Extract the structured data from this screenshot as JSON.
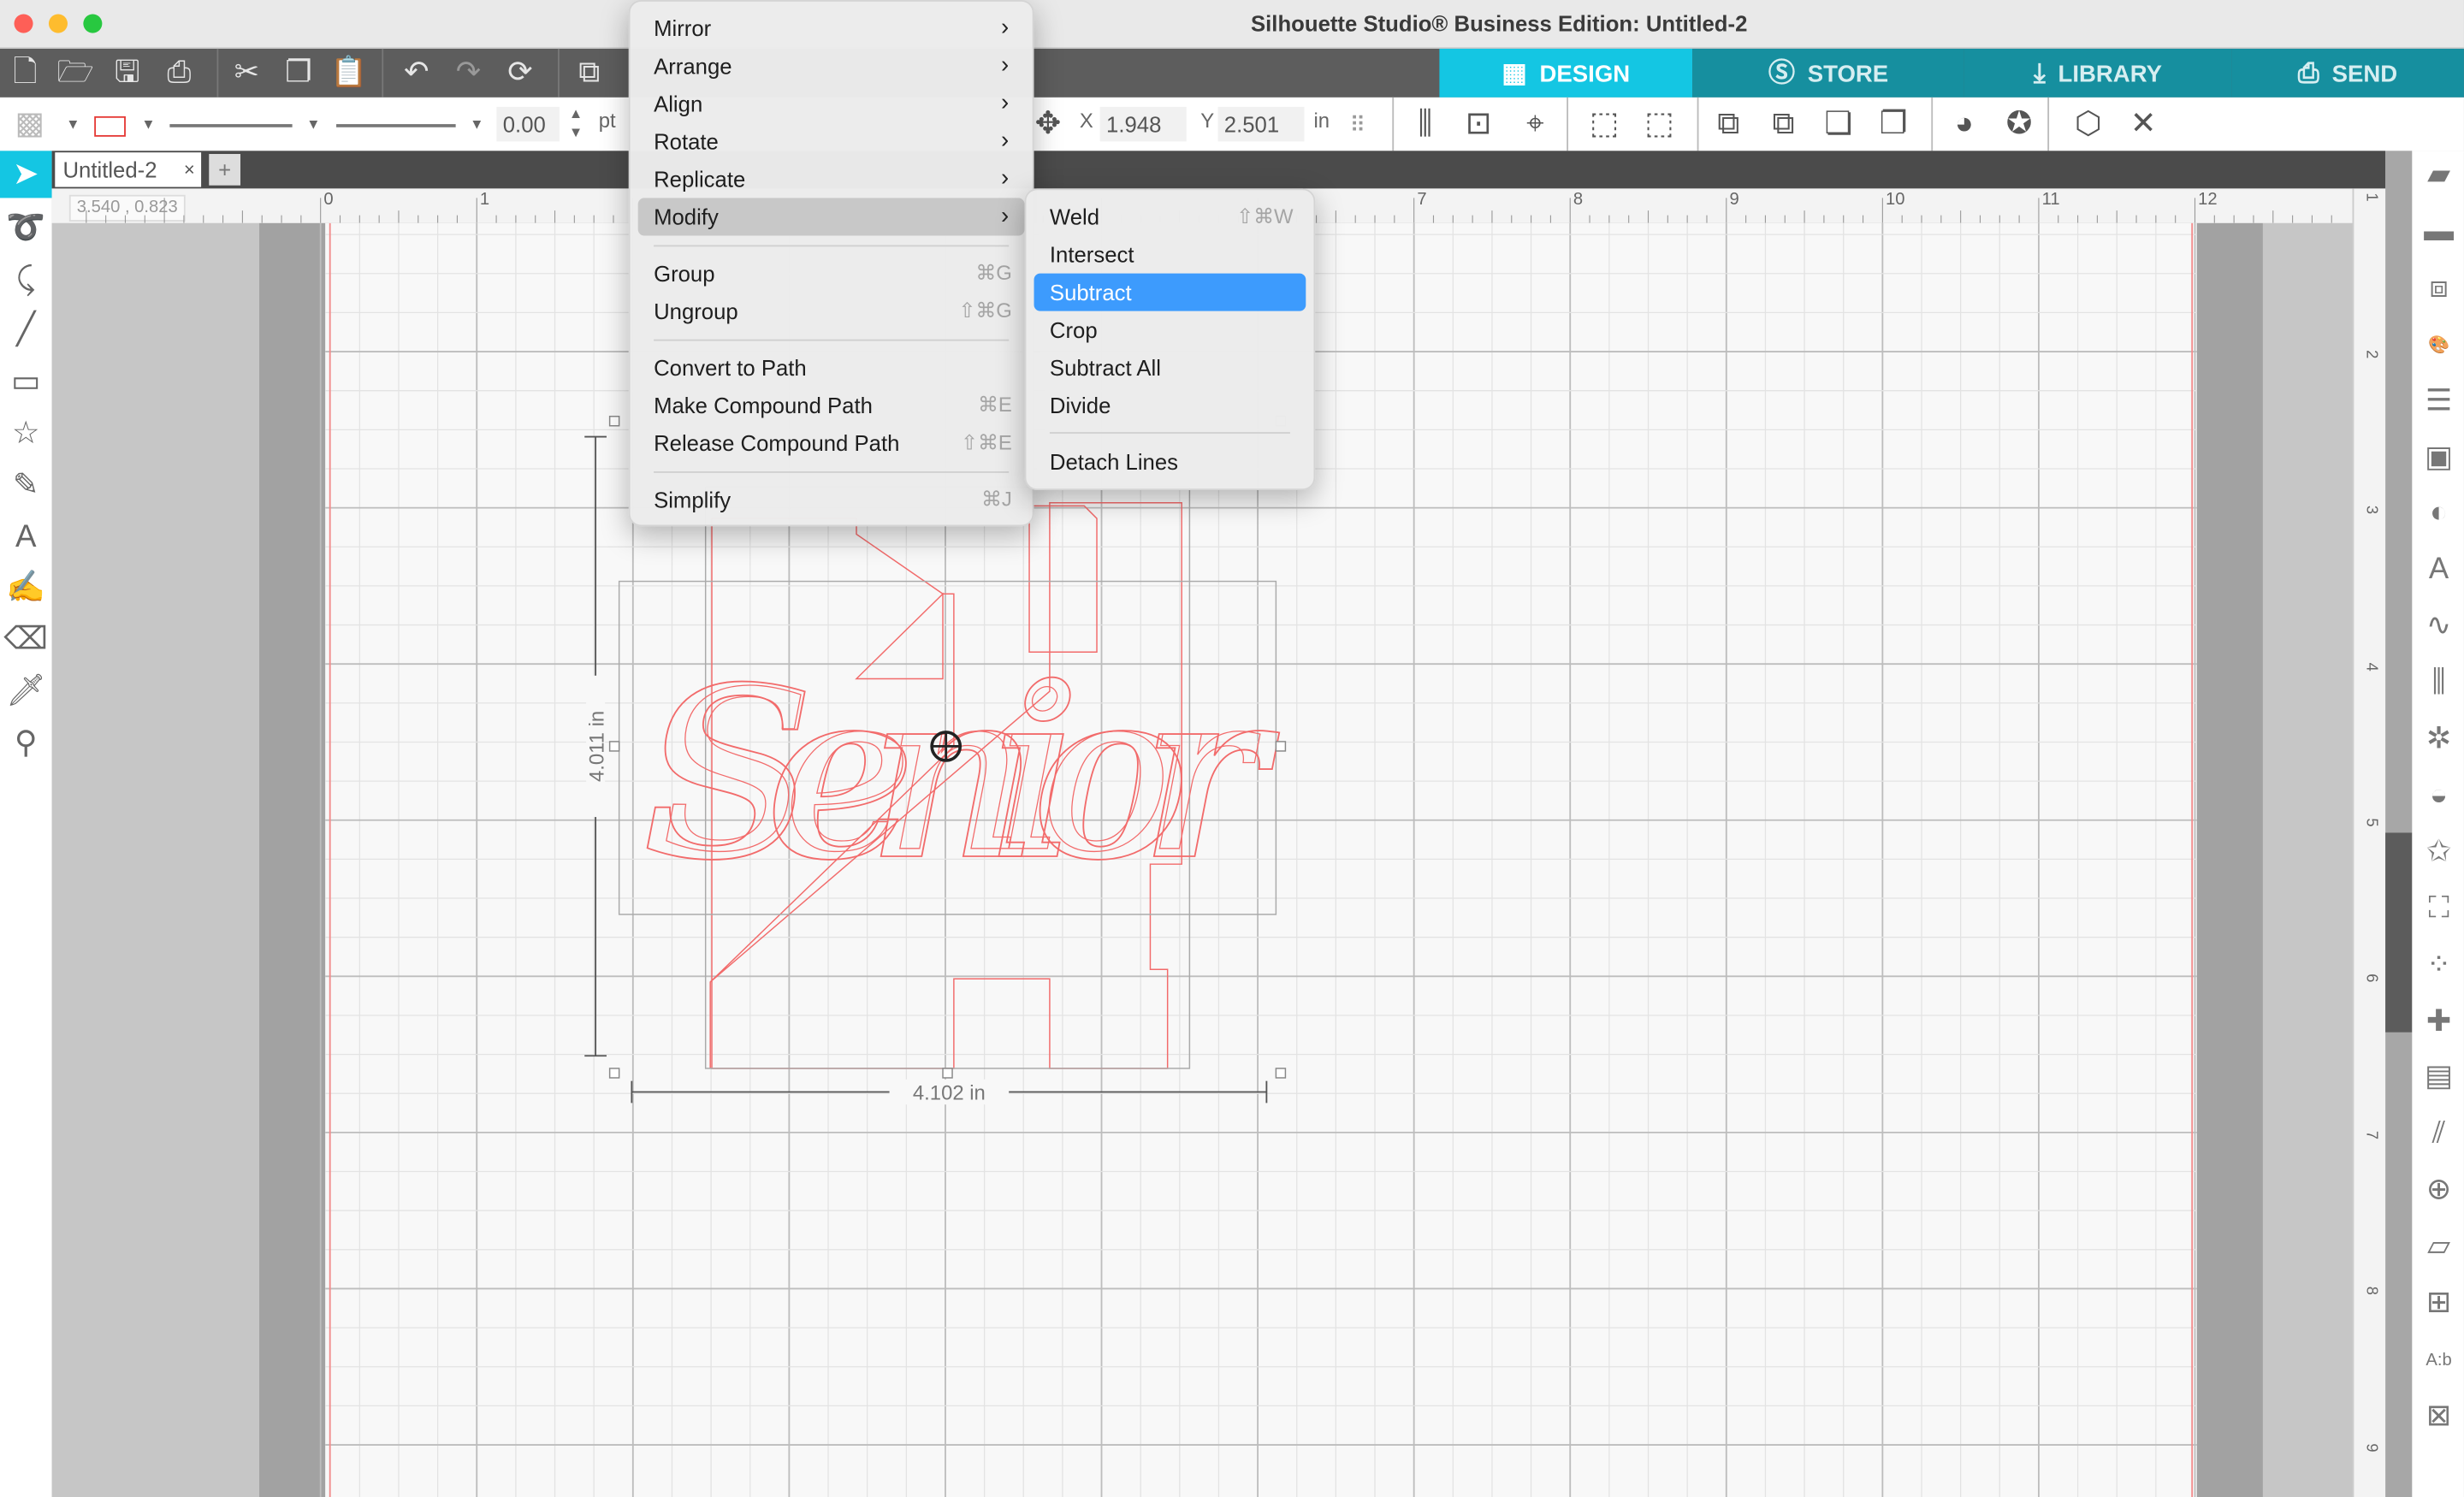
{
  "window": {
    "title": "Silhouette Studio® Business Edition: Untitled-2"
  },
  "toolbar_top": {
    "icons": [
      "new-document-icon",
      "open-folder-icon",
      "save-icon",
      "print-icon",
      "cut-icon",
      "copy-icon",
      "paste-icon",
      "undo-icon",
      "redo-icon",
      "redraw-icon",
      "group-select-icon"
    ],
    "nav_tabs": [
      {
        "label": "DESIGN",
        "icon": "design-grid-icon",
        "active": true
      },
      {
        "label": "STORE",
        "icon": "store-s-icon",
        "active": false
      },
      {
        "label": "LIBRARY",
        "icon": "library-download-icon",
        "active": false
      },
      {
        "label": "SEND",
        "icon": "send-printer-icon",
        "active": false
      }
    ],
    "colors": {
      "active_tab": "#14c6e3",
      "inactive_tab": "#168f9f",
      "toolbar_bg": "#5d5d5d"
    }
  },
  "toolbar_props": {
    "line_width": "0.00",
    "line_unit": "pt",
    "x_label": "X",
    "x_value": "1.948",
    "y_label": "Y",
    "y_value": "2.501",
    "pos_unit": "in",
    "line_color": "#e53935",
    "right_icons": [
      "align-icon",
      "center-page-icon",
      "crosshair-center-icon",
      "group-icon",
      "ungroup-icon",
      "bring-forward-icon",
      "send-backward-icon",
      "bring-to-front-icon",
      "send-to-back-icon",
      "shape-fill-icon",
      "star-offset-icon",
      "3d-box-icon",
      "delete-icon"
    ]
  },
  "doc_tabs": {
    "tabs": [
      {
        "label": "Untitled-2",
        "close": "×"
      }
    ],
    "add": "+"
  },
  "ruler": {
    "coord_readout": "3.540 , 0.823",
    "h_labels": [
      "0",
      "1",
      "7",
      "8",
      "9",
      "10",
      "11",
      "12"
    ],
    "v_labels": [
      "1",
      "2",
      "3",
      "4",
      "5",
      "6",
      "7",
      "8",
      "9"
    ]
  },
  "left_tools": [
    "select-arrow-icon",
    "point-edit-icon",
    "curve-icon",
    "line-icon",
    "rectangle-icon",
    "star-shape-icon",
    "pencil-icon",
    "text-icon",
    "text-edit-icon",
    "eraser-icon",
    "knife-icon",
    "eyedropper-icon"
  ],
  "right_panel": [
    "page-setup-icon",
    "send-panel-icon",
    "pixscan-icon",
    "color-palette-icon",
    "line-style-icon",
    "fill-pattern-icon",
    "shadow-icon",
    "text-style-icon",
    "sketch-icon",
    "align-panel-icon",
    "replicate-icon",
    "modify-icon",
    "offset-icon",
    "trace-icon",
    "rhinestone-icon",
    "puzzle-icon",
    "library-icon",
    "hatch-icon",
    "3d-globe-icon",
    "transform-icon",
    "warp-icon",
    "text-to-path-icon",
    "nesting-icon"
  ],
  "design": {
    "width_label": "4.102 in",
    "height_label": "4.011 in",
    "text": "Senior",
    "numeral": "4",
    "stroke_color": "#f26b6b"
  },
  "menu": {
    "items": [
      {
        "label": "Mirror",
        "submenu": true
      },
      {
        "label": "Arrange",
        "submenu": true
      },
      {
        "label": "Align",
        "submenu": true
      },
      {
        "label": "Rotate",
        "submenu": true
      },
      {
        "label": "Replicate",
        "submenu": true
      },
      {
        "label": "Modify",
        "submenu": true,
        "highlighted": true
      },
      {
        "label": "Group",
        "shortcut": "⌘G"
      },
      {
        "label": "Ungroup",
        "shortcut": "⇧⌘G"
      },
      {
        "label": "Convert to Path",
        "shortcut": ""
      },
      {
        "label": "Make Compound Path",
        "shortcut": "⌘E"
      },
      {
        "label": "Release Compound Path",
        "shortcut": "⇧⌘E"
      },
      {
        "label": "Simplify",
        "shortcut": "⌘J"
      }
    ],
    "submenu_arrow": "›"
  },
  "submenu": {
    "items": [
      {
        "label": "Weld",
        "shortcut": "⇧⌘W"
      },
      {
        "label": "Intersect",
        "shortcut": ""
      },
      {
        "label": "Subtract",
        "shortcut": "",
        "selected": true
      },
      {
        "label": "Crop",
        "shortcut": ""
      },
      {
        "label": "Subtract All",
        "shortcut": ""
      },
      {
        "label": "Divide",
        "shortcut": ""
      },
      {
        "label": "Detach Lines",
        "shortcut": ""
      }
    ],
    "selected_color": "#3d9bfd"
  }
}
